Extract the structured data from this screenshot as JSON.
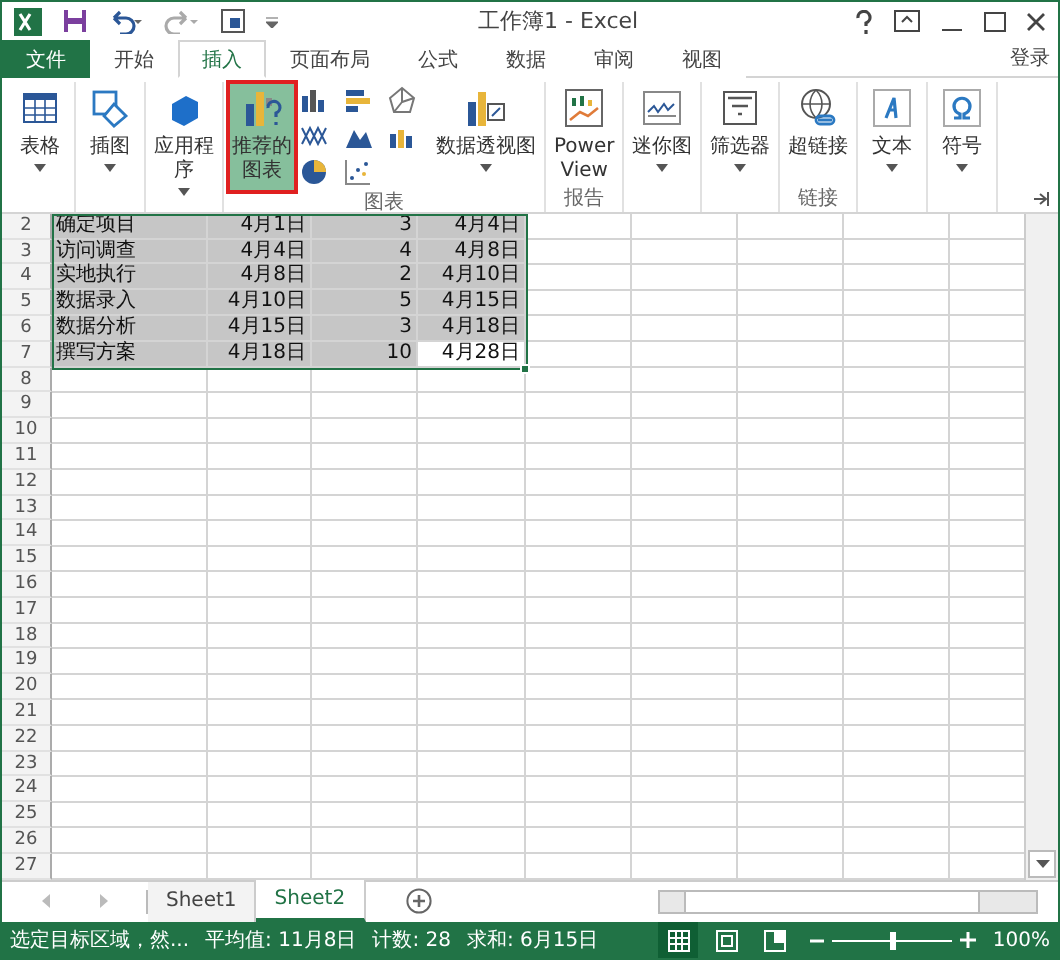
{
  "window": {
    "title": "工作簿1 - Excel",
    "sign_in": "登录"
  },
  "tabs": [
    {
      "label": "文件",
      "kind": "file",
      "selected": false
    },
    {
      "label": "开始",
      "kind": "tab",
      "selected": false
    },
    {
      "label": "插入",
      "kind": "tab",
      "selected": true
    },
    {
      "label": "页面布局",
      "kind": "tab",
      "selected": false
    },
    {
      "label": "公式",
      "kind": "tab",
      "selected": false
    },
    {
      "label": "数据",
      "kind": "tab",
      "selected": false
    },
    {
      "label": "审阅",
      "kind": "tab",
      "selected": false
    },
    {
      "label": "视图",
      "kind": "tab",
      "selected": false
    }
  ],
  "ribbon": {
    "groups": [
      {
        "buttons": [
          {
            "kind": "large",
            "lines": [
              "表格"
            ],
            "dropdown": true,
            "highlighted": false
          }
        ]
      },
      {
        "buttons": [
          {
            "kind": "large",
            "lines": [
              "插图"
            ],
            "dropdown": true,
            "highlighted": false
          }
        ]
      },
      {
        "buttons": [
          {
            "kind": "large",
            "lines": [
              "应用程",
              "序"
            ],
            "dropdown": true,
            "highlighted": false
          }
        ]
      },
      {
        "label": "图表",
        "buttons": [
          {
            "kind": "large",
            "lines": [
              "推荐的",
              "图表"
            ],
            "dropdown": false,
            "highlighted": true
          },
          {
            "kind": "gallery"
          },
          {
            "kind": "large",
            "lines": [
              "数据透视图"
            ],
            "dropdown": true,
            "highlighted": false
          }
        ]
      },
      {
        "label": "报告",
        "buttons": [
          {
            "kind": "large",
            "lines": [
              "Power",
              "View"
            ],
            "dropdown": false,
            "highlighted": false
          }
        ]
      },
      {
        "buttons": [
          {
            "kind": "large",
            "lines": [
              "迷你图"
            ],
            "dropdown": true,
            "highlighted": false
          }
        ]
      },
      {
        "buttons": [
          {
            "kind": "large",
            "lines": [
              "筛选器"
            ],
            "dropdown": true,
            "highlighted": false
          }
        ]
      },
      {
        "label": "链接",
        "buttons": [
          {
            "kind": "large",
            "lines": [
              "超链接"
            ],
            "dropdown": false,
            "highlighted": false
          }
        ]
      },
      {
        "buttons": [
          {
            "kind": "large",
            "lines": [
              "文本"
            ],
            "dropdown": true,
            "highlighted": false
          }
        ]
      },
      {
        "buttons": [
          {
            "kind": "large",
            "lines": [
              "符号"
            ],
            "dropdown": true,
            "highlighted": false
          }
        ]
      }
    ]
  },
  "sheet": {
    "rows": [
      {
        "number": "2",
        "cells": [
          {
            "text": "确定项目",
            "selected": true
          },
          {
            "text": "4月1日",
            "selected": true
          },
          {
            "text": "3",
            "selected": true
          },
          {
            "text": "4月4日",
            "selected": true
          }
        ]
      },
      {
        "number": "3",
        "cells": [
          {
            "text": "访问调查",
            "selected": true
          },
          {
            "text": "4月4日",
            "selected": true
          },
          {
            "text": "4",
            "selected": true
          },
          {
            "text": "4月8日",
            "selected": true
          }
        ]
      },
      {
        "number": "4",
        "cells": [
          {
            "text": "实地执行",
            "selected": true
          },
          {
            "text": "4月8日",
            "selected": true
          },
          {
            "text": "2",
            "selected": true
          },
          {
            "text": "4月10日",
            "selected": true
          }
        ]
      },
      {
        "number": "5",
        "cells": [
          {
            "text": "数据录入",
            "selected": true
          },
          {
            "text": "4月10日",
            "selected": true
          },
          {
            "text": "5",
            "selected": true
          },
          {
            "text": "4月15日",
            "selected": true
          }
        ]
      },
      {
        "number": "6",
        "cells": [
          {
            "text": "数据分析",
            "selected": true
          },
          {
            "text": "4月15日",
            "selected": true
          },
          {
            "text": "3",
            "selected": true
          },
          {
            "text": "4月18日",
            "selected": true
          }
        ]
      },
      {
        "number": "7",
        "cells": [
          {
            "text": "撰写方案",
            "selected": true
          },
          {
            "text": "4月18日",
            "selected": true
          },
          {
            "text": "10",
            "selected": true
          },
          {
            "text": "4月28日",
            "selected": false
          }
        ]
      },
      {
        "number": "8"
      },
      {
        "number": "9"
      },
      {
        "number": "10"
      },
      {
        "number": "11"
      },
      {
        "number": "12"
      },
      {
        "number": "13"
      },
      {
        "number": "14"
      },
      {
        "number": "15"
      },
      {
        "number": "16"
      },
      {
        "number": "17"
      },
      {
        "number": "18"
      },
      {
        "number": "19"
      },
      {
        "number": "20"
      },
      {
        "number": "21"
      },
      {
        "number": "22"
      },
      {
        "number": "23"
      },
      {
        "number": "24"
      },
      {
        "number": "25"
      },
      {
        "number": "26"
      },
      {
        "number": "27"
      }
    ]
  },
  "sheet_tabs": [
    {
      "label": "Sheet1",
      "selected": false
    },
    {
      "label": "Sheet2",
      "selected": true
    }
  ],
  "status_bar": {
    "message": "选定目标区域，然...",
    "average": "平均值: 11月8日",
    "count": "计数: 28",
    "sum": "求和: 6月15日",
    "zoom": {
      "level": 0.5,
      "reading": "100%"
    }
  }
}
